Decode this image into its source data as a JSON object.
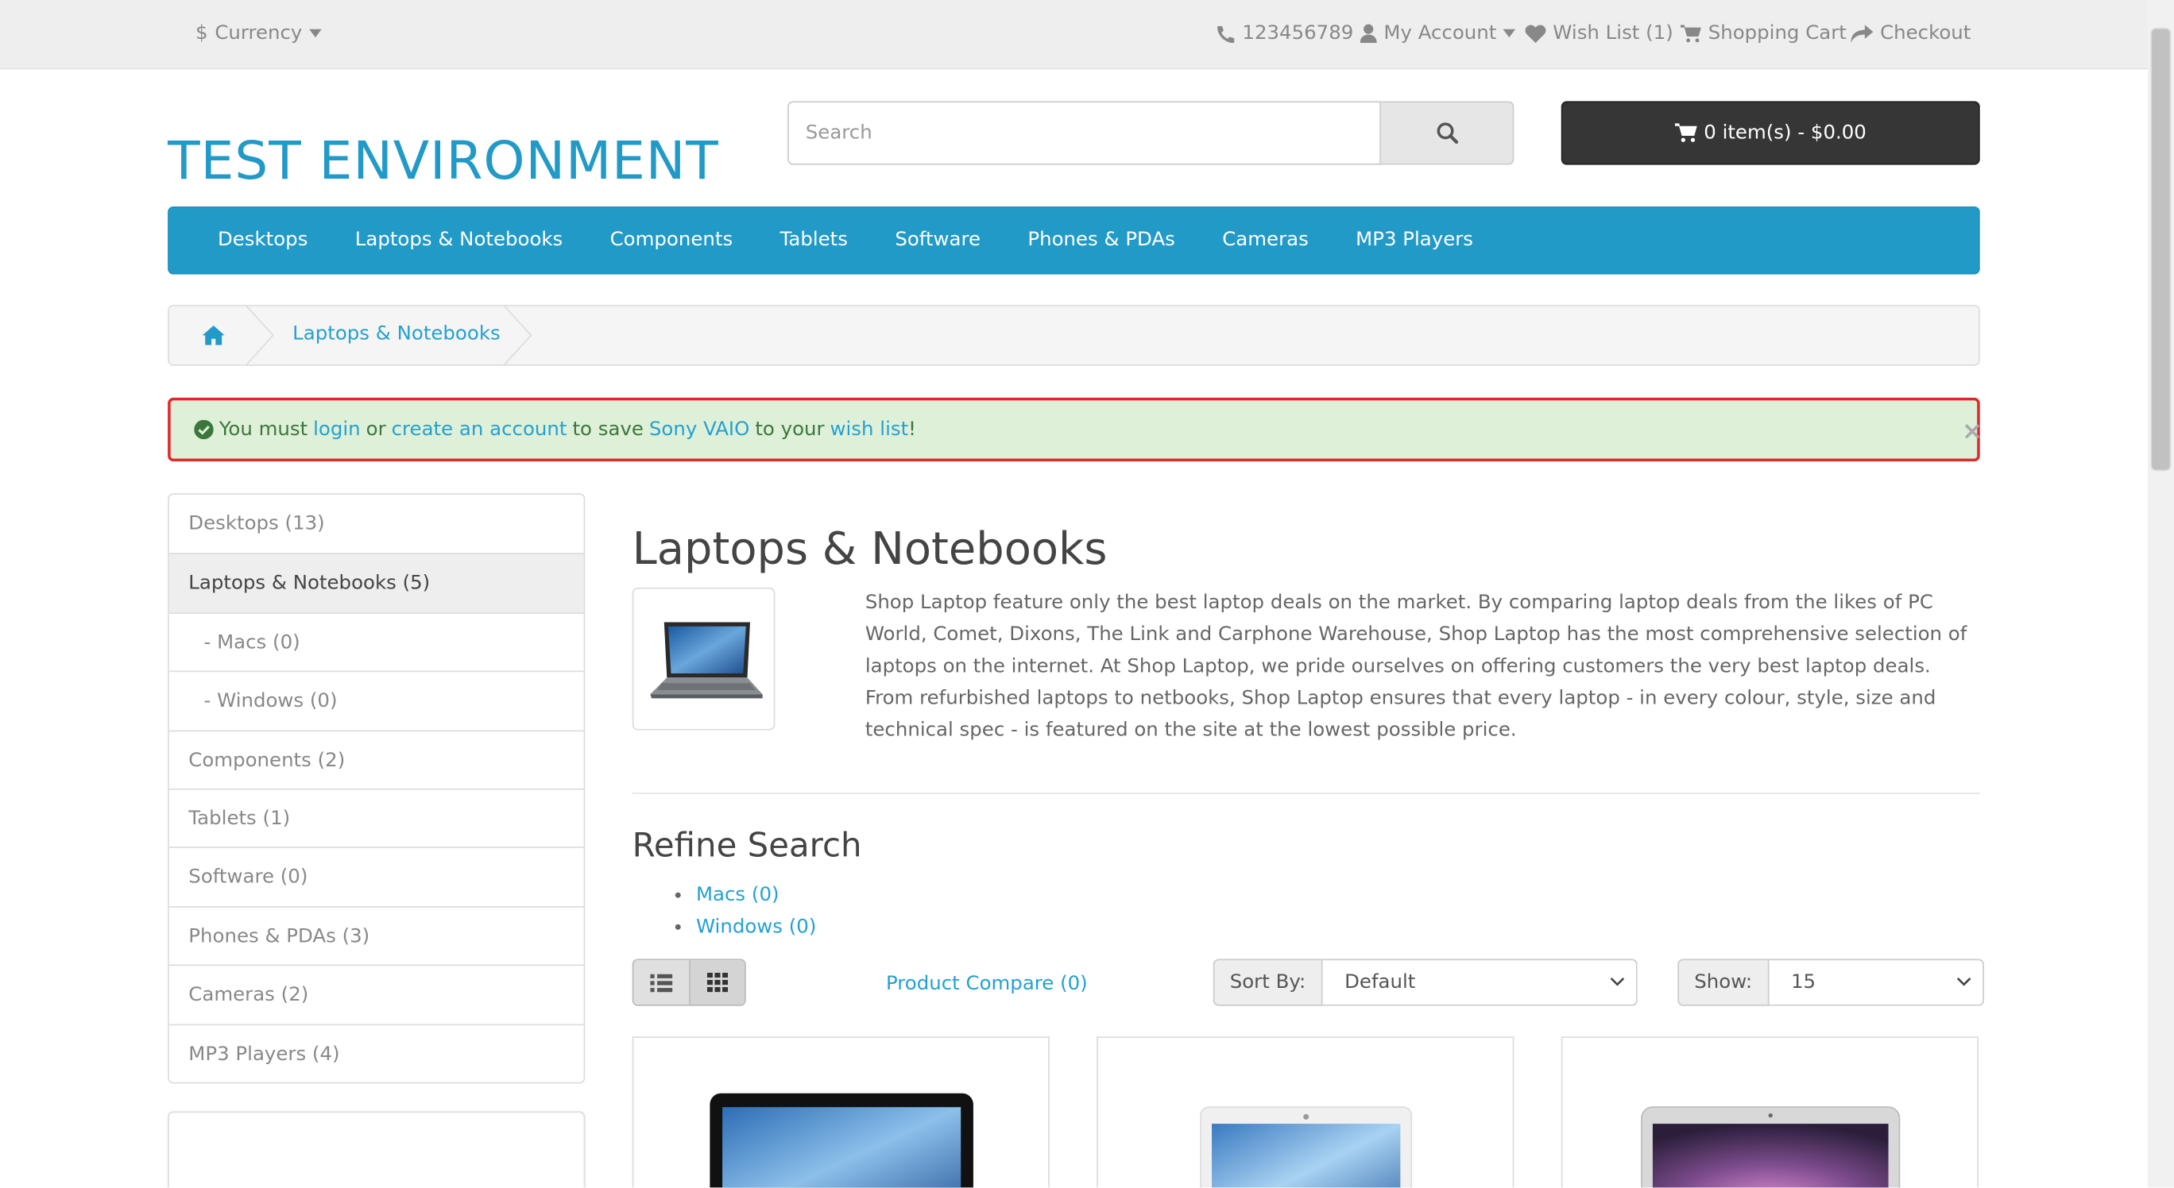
{
  "topbar": {
    "currency": "Currency",
    "phone": "123456789",
    "account": "My Account",
    "wishlist": "Wish List (1)",
    "cart": "Shopping Cart",
    "checkout": "Checkout"
  },
  "header": {
    "logo": "TEST ENVIRONMENT",
    "search_placeholder": "Search",
    "cart_total": "0 item(s) - $0.00"
  },
  "menu": [
    "Desktops",
    "Laptops & Notebooks",
    "Components",
    "Tablets",
    "Software",
    "Phones & PDAs",
    "Cameras",
    "MP3 Players"
  ],
  "breadcrumb": {
    "current": "Laptops & Notebooks"
  },
  "alert": {
    "p1": "You must",
    "login": "login",
    "or": "or",
    "create": "create an account",
    "p2": "to save",
    "product": "Sony VAIO",
    "p3": "to your",
    "wishlist": "wish list",
    "end": "!",
    "close": "×"
  },
  "sidebar": {
    "items": [
      {
        "label": "Desktops (13)"
      },
      {
        "label": "Laptops & Notebooks (5)"
      },
      {
        "label": "- Macs (0)"
      },
      {
        "label": "- Windows (0)"
      },
      {
        "label": "Components (2)"
      },
      {
        "label": "Tablets (1)"
      },
      {
        "label": "Software (0)"
      },
      {
        "label": "Phones & PDAs (3)"
      },
      {
        "label": "Cameras (2)"
      },
      {
        "label": "MP3 Players (4)"
      }
    ]
  },
  "category": {
    "title": "Laptops & Notebooks",
    "description": "Shop Laptop feature only the best laptop deals on the market. By comparing laptop deals from the likes of PC World, Comet, Dixons, The Link and Carphone Warehouse, Shop Laptop has the most comprehensive selection of laptops on the internet. At Shop Laptop, we pride ourselves on offering customers the very best laptop deals. From refurbished laptops to netbooks, Shop Laptop ensures that every laptop - in every colour, style, size and technical spec - is featured on the site at the lowest possible price.",
    "refine_title": "Refine Search",
    "refine": [
      "Macs (0)",
      "Windows (0)"
    ]
  },
  "toolbar": {
    "compare": "Product Compare (0)",
    "sort_label": "Sort By:",
    "sort_value": "Default",
    "show_label": "Show:",
    "show_value": "15"
  },
  "colors": {
    "brand": "#229ac8",
    "alert_border": "#e3262a",
    "alert_bg": "#dff0d8"
  }
}
